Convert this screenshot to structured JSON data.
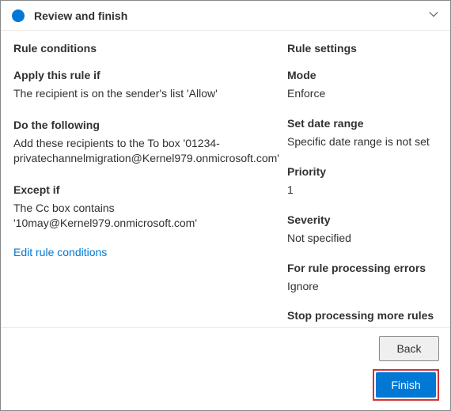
{
  "header": {
    "title": "Review and finish"
  },
  "left": {
    "heading": "Rule conditions",
    "apply_label": "Apply this rule if",
    "apply_text": "The recipient is on the sender's list 'Allow'",
    "do_label": "Do the following",
    "do_text": "Add these recipients to the To box '01234-privatechannelmigration@Kernel979.onmicrosoft.com'",
    "except_label": "Except if",
    "except_text": "The Cc box contains '10may@Kernel979.onmicrosoft.com'",
    "edit_link": "Edit rule conditions"
  },
  "right": {
    "heading": "Rule settings",
    "mode_label": "Mode",
    "mode_value": "Enforce",
    "date_label": "Set date range",
    "date_value": "Specific date range is not set",
    "priority_label": "Priority",
    "priority_value": "1",
    "severity_label": "Severity",
    "severity_value": "Not specified",
    "errors_label": "For rule processing errors",
    "errors_value": "Ignore",
    "stop_label": "Stop processing more rules",
    "stop_value": "false"
  },
  "footer": {
    "back": "Back",
    "finish": "Finish"
  }
}
